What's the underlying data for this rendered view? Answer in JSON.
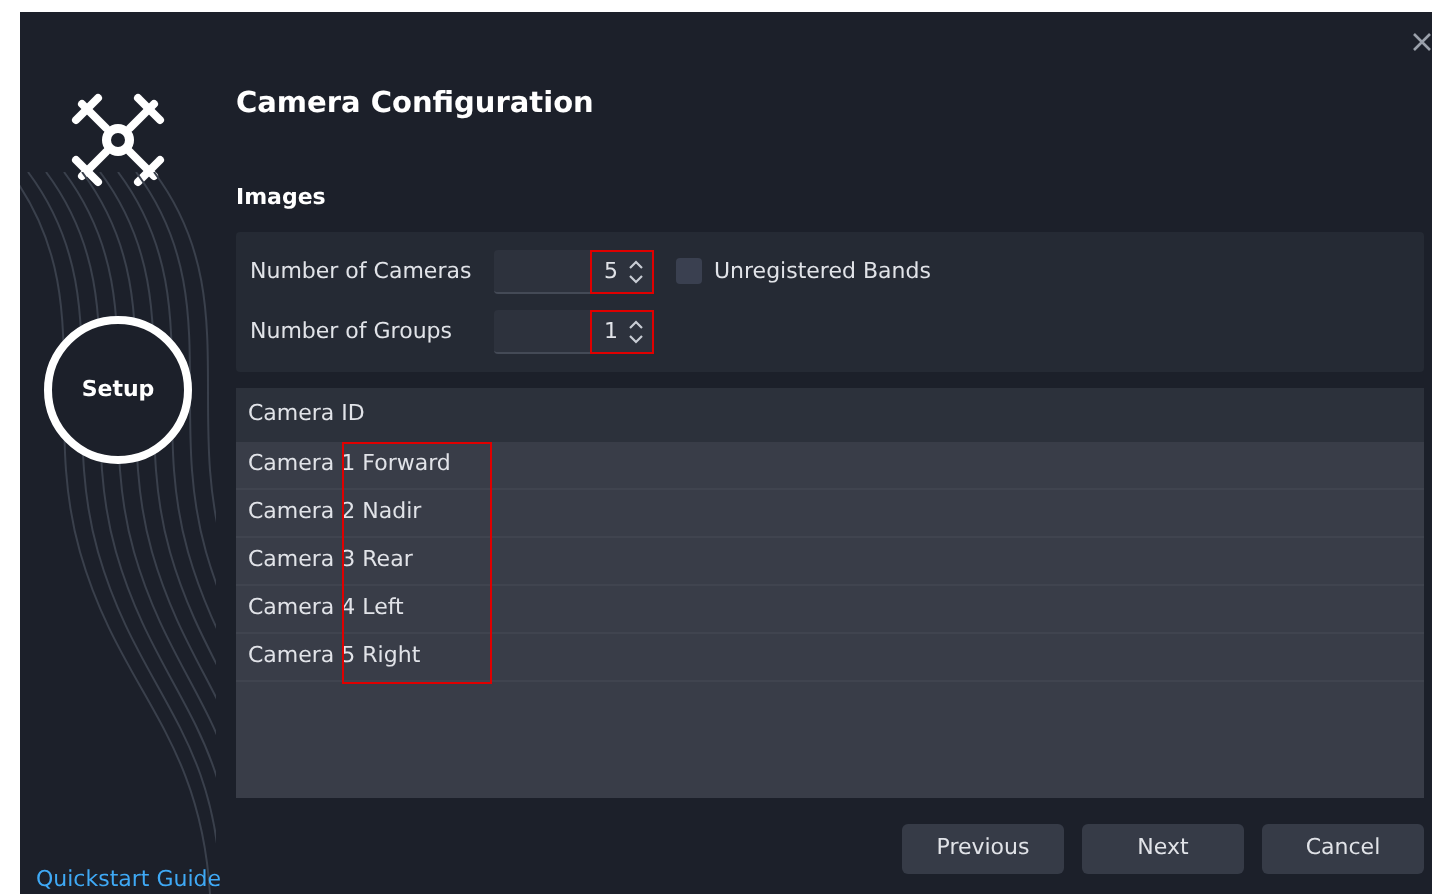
{
  "sidebar": {
    "step": "Setup",
    "link": "Quickstart Guide"
  },
  "title": "Camera Configuration",
  "section": "Images",
  "fields": [
    {
      "label": "Number of Cameras",
      "value": "5"
    },
    {
      "label": "Number of Groups",
      "value": "1"
    }
  ],
  "checkbox": {
    "label": "Unregistered Bands",
    "checked": false
  },
  "table": {
    "columns": [
      "Camera ID"
    ],
    "rows": [
      "Camera 1 Forward",
      "Camera 2 Nadir",
      "Camera 3 Rear",
      "Camera 4 Left",
      "Camera 5 Right"
    ]
  },
  "buttons": [
    "Previous",
    "Next",
    "Cancel"
  ]
}
